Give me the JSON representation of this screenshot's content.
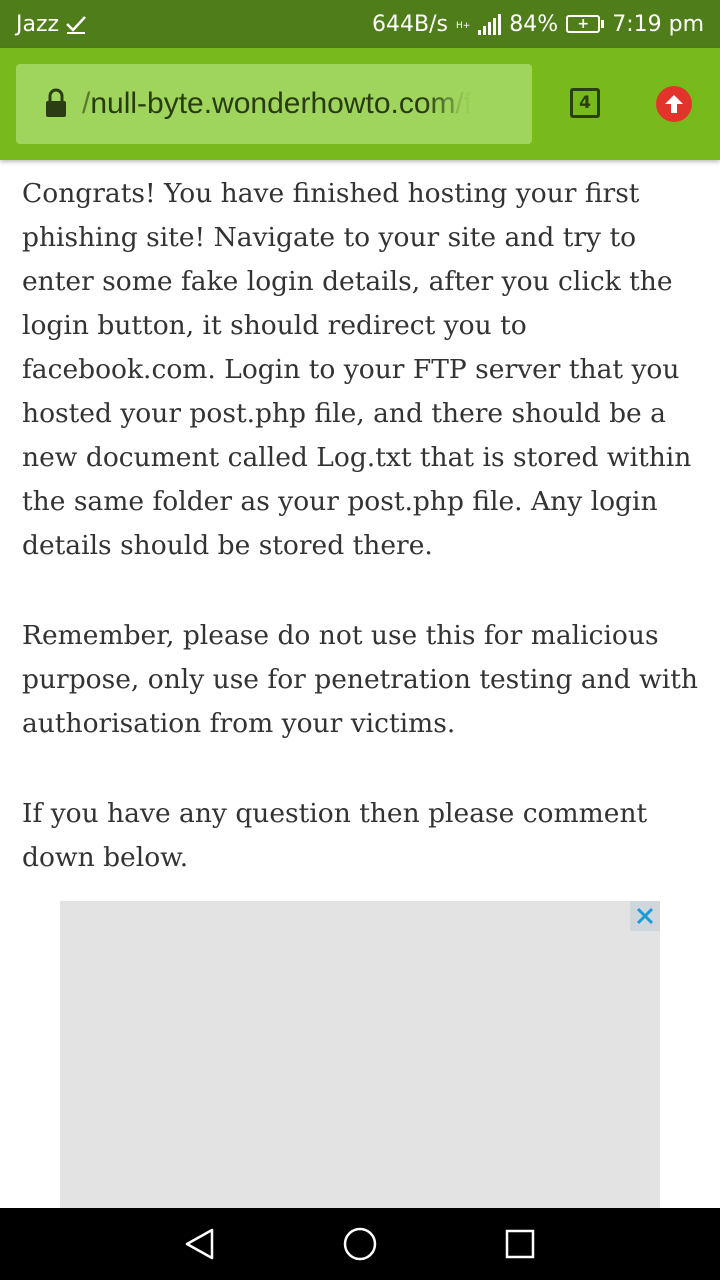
{
  "status_bar": {
    "carrier": "Jazz",
    "network_speed": "644B/s",
    "network_type": "H+",
    "battery_percent": "84%",
    "time": "7:19 pm"
  },
  "browser": {
    "url": "/null-byte.wonderhowto.com/f",
    "url_prefix": "/",
    "url_domain": "null-byte.wonderhowto.com",
    "url_suffix": "/f",
    "tab_count": "4",
    "theme_color": "#78b91c",
    "status_color": "#4f7d1a"
  },
  "article": {
    "paragraphs": [
      "Congrats! You have finished hosting your first phishing site! Navigate to your site and try to enter some fake login details, after you click the login button, it should redirect you to facebook.com. Login to your FTP server that you hosted your post.php file, and there should be a new document called Log.txt that is stored within the same folder as your post.php file. Any login details should be stored there.",
      "Remember, please do not use this for malicious purpose, only use for penetration testing and with authorisation from your victims.",
      "If you have any question then please comment down below."
    ]
  },
  "icons": {
    "lock": "lock-icon",
    "upload": "arrow-up-icon",
    "ad_close": "close-icon",
    "back": "back-triangle-icon",
    "home": "home-circle-icon",
    "recents": "recents-square-icon"
  }
}
